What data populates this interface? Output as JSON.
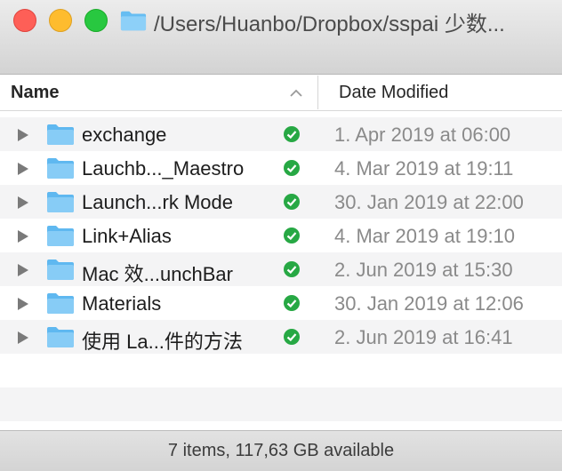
{
  "window": {
    "title": "/Users/Huanbo/Dropbox/sspai 少数...",
    "title_icon": "folder-icon"
  },
  "columns": {
    "name": "Name",
    "date": "Date Modified",
    "sort_indicator": "chevron-up-icon"
  },
  "colors": {
    "folder": "#5fb8f0",
    "sync_ok": "#27a844",
    "close": "#fe5f57",
    "minimize": "#febc2e",
    "maximize": "#28c840"
  },
  "rows": [
    {
      "name": "exchange",
      "date": "1. Apr 2019 at 06:00",
      "status": "synced-check-icon"
    },
    {
      "name": "Lauchb..._Maestro",
      "date": "4. Mar 2019 at 19:11",
      "status": "synced-check-icon"
    },
    {
      "name": "Launch...rk Mode",
      "date": "30. Jan 2019 at 22:00",
      "status": "synced-check-icon"
    },
    {
      "name": "Link+Alias",
      "date": "4. Mar 2019 at 19:10",
      "status": "synced-check-icon"
    },
    {
      "name": "Mac 效...unchBar",
      "date": "2. Jun 2019 at 15:30",
      "status": "synced-check-icon"
    },
    {
      "name": "Materials",
      "date": "30. Jan 2019 at 12:06",
      "status": "synced-check-icon"
    },
    {
      "name": "使用 La...件的方法",
      "date": "2. Jun 2019 at 16:41",
      "status": "synced-check-icon"
    }
  ],
  "status_bar": {
    "text": "7 items, 117,63 GB available"
  }
}
